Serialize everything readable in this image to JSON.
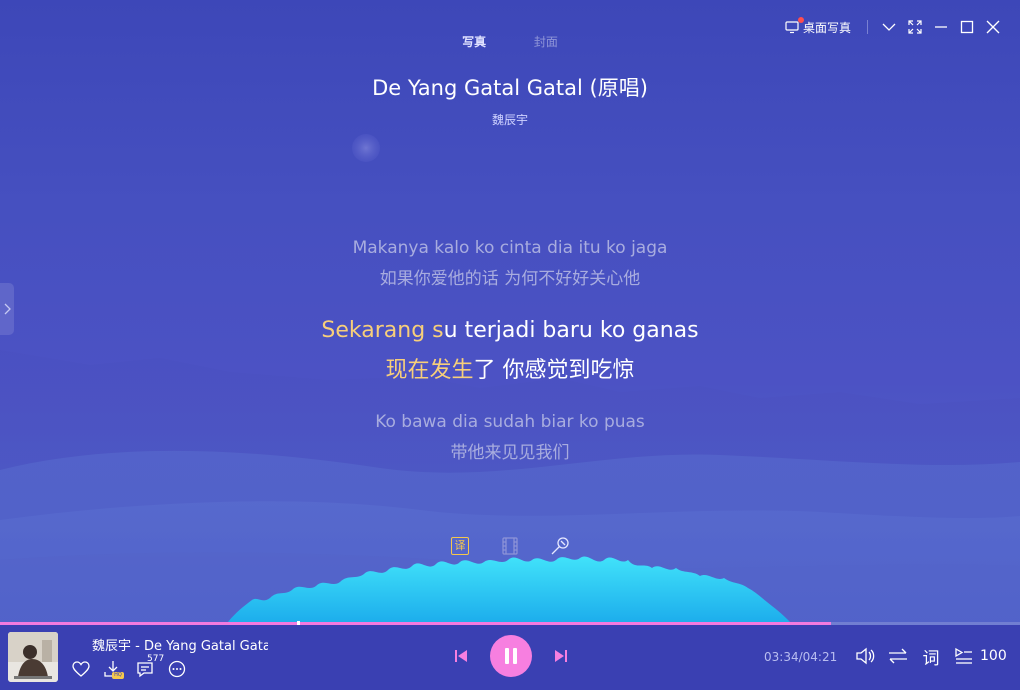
{
  "header": {
    "tabs": [
      {
        "label": "写真",
        "active": true
      },
      {
        "label": "封面",
        "active": false
      }
    ],
    "desktop_photo_label": "桌面写真"
  },
  "song": {
    "title": "De Yang Gatal Gatal (原唱)",
    "artist": "魏辰宇"
  },
  "lyrics": {
    "previous": {
      "original": "Makanya kalo ko cinta dia itu ko jaga",
      "translation": "如果你爱他的话 为何不好好关心他"
    },
    "current": {
      "original_sung": "Sekarang s",
      "original_rest": "u terjadi baru ko ganas",
      "translation_sung": "现在发生",
      "translation_rest": "了 你感觉到吃惊"
    },
    "next": {
      "original": "Ko bawa dia sudah biar ko puas",
      "translation": "带他来见见我们"
    }
  },
  "lyric_tools": {
    "translate_label": "译"
  },
  "player": {
    "now_playing": "魏辰宇 - De Yang Gatal Gatal",
    "comment_count": "577",
    "download_badge": "HQ",
    "time_current": "03:34",
    "time_total": "04:21",
    "time_display": "03:34/04:21",
    "progress_fraction": 0.815,
    "lyrics_button": "词",
    "playlist_count": "100"
  },
  "colors": {
    "accent_pink": "#f77fe0",
    "lyric_highlight": "#f7cf7a",
    "background": "#4650c0"
  }
}
